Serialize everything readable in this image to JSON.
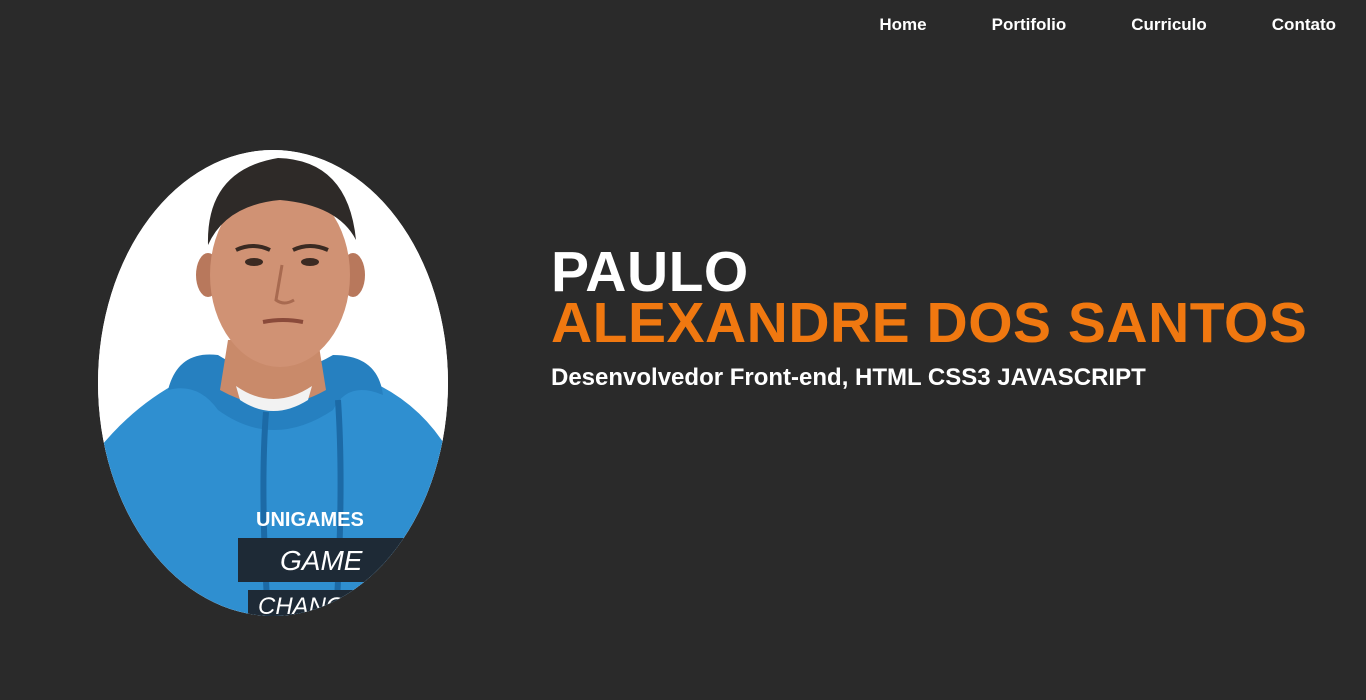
{
  "nav": {
    "items": [
      {
        "label": "Home"
      },
      {
        "label": "Portifolio"
      },
      {
        "label": "Curriculo"
      },
      {
        "label": "Contato"
      }
    ]
  },
  "hero": {
    "first_name": "PAULO",
    "last_name": "ALEXANDRE DOS SANTOS",
    "role": "Desenvolvedor Front-end, HTML CSS3 JAVASCRIPT"
  },
  "avatar": {
    "shirt_text_1": "UNIGAMES",
    "shirt_text_2": "GAME",
    "shirt_text_3": "CHANGE"
  },
  "colors": {
    "background": "#2a2a2a",
    "accent": "#f07810",
    "text": "#ffffff",
    "hoodie": "#2f8fd0"
  }
}
